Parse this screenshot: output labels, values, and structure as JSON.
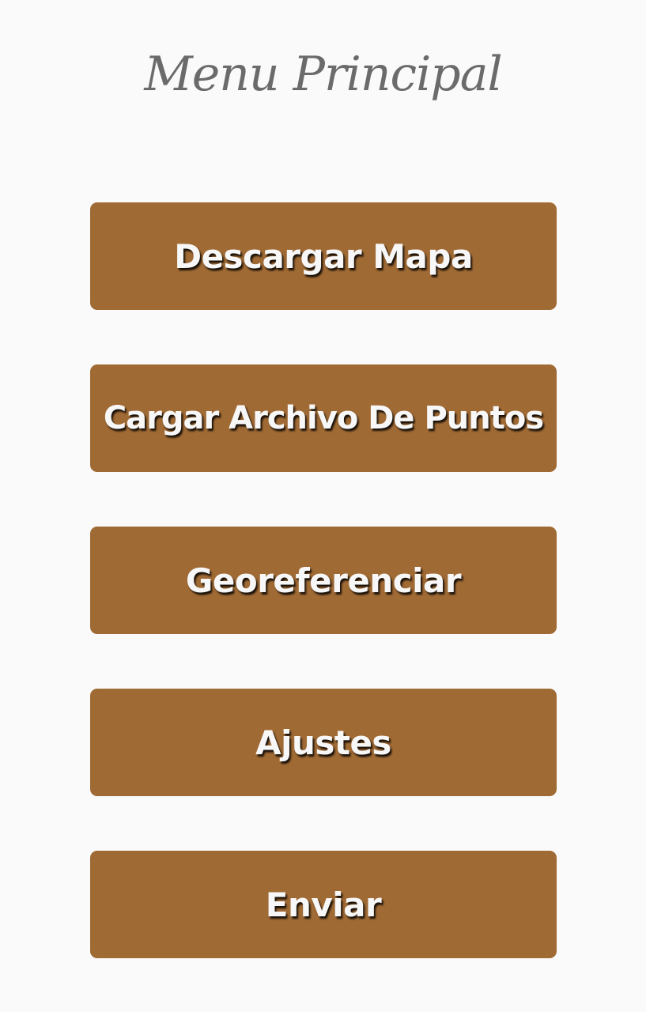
{
  "header": {
    "title": "Menu Principal"
  },
  "menu": {
    "buttons": [
      {
        "label": "Descargar Mapa"
      },
      {
        "label": "Cargar Archivo De Puntos"
      },
      {
        "label": "Georeferenciar"
      },
      {
        "label": "Ajustes"
      },
      {
        "label": "Enviar"
      }
    ]
  },
  "colors": {
    "background": "#fafafa",
    "button": "#a06a34",
    "button_text": "#f7f7f7",
    "title_text": "#6b6b6b"
  }
}
